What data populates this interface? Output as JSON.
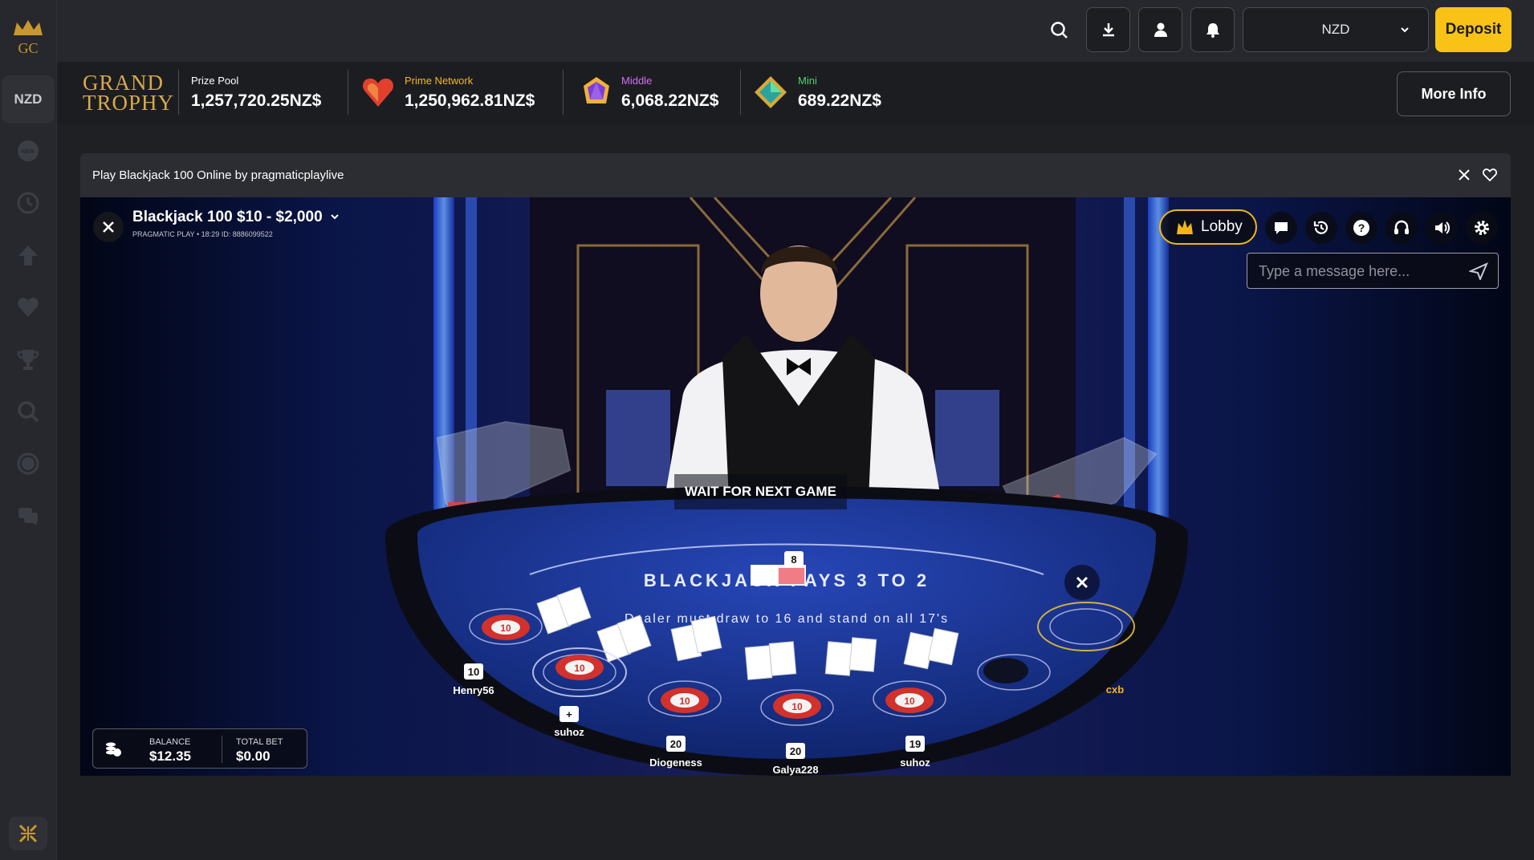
{
  "sidebar": {
    "logo_text": "GC",
    "currency": "NZD",
    "items": [
      {
        "icon": "new-icon"
      },
      {
        "icon": "recent-icon"
      },
      {
        "icon": "top-icon"
      },
      {
        "icon": "favorites-icon"
      },
      {
        "icon": "trophy-icon"
      },
      {
        "icon": "search-icon"
      },
      {
        "icon": "live-icon"
      },
      {
        "icon": "chat-icon"
      }
    ],
    "bottom_icon": "collapse-icon"
  },
  "topbar": {
    "currency_select": "NZD",
    "deposit_label": "Deposit"
  },
  "jackpot": {
    "logo_line1": "GRAND",
    "logo_line2": "TROPHY",
    "prize_pool_label": "Prize Pool",
    "prize_pool_value": "1,257,720.25NZ$",
    "prime_label": "Prime Network",
    "prime_value": "1,250,962.81NZ$",
    "middle_label": "Middle",
    "middle_value": "6,068.22NZ$",
    "mini_label": "Mini",
    "mini_value": "689.22NZ$",
    "more_info_label": "More Info",
    "colors": {
      "prime": "#f4b728",
      "middle": "#d56ef5",
      "mini": "#4fd27a"
    }
  },
  "game_panel": {
    "title": "Play Blackjack 100 Online by pragmaticplaylive",
    "game_title": "Blackjack 100 $10 - $2,000",
    "game_sub": "PRAGMATIC PLAY • 18:29  ID: 8886099522",
    "lobby_label": "Lobby",
    "chat_placeholder": "Type a message here...",
    "status": "WAIT FOR NEXT GAME",
    "table_text_1": "BLACKJACK PAYS 3 TO 2",
    "table_text_2": "Dealer must draw to 16 and stand on all 17's",
    "dealer_card_value": "8",
    "seats": [
      {
        "name": "Henry56",
        "score": "10"
      },
      {
        "name": "suhoz",
        "score": "+"
      },
      {
        "name": "Diogeness",
        "score": "20"
      },
      {
        "name": "Galya228",
        "score": "20"
      },
      {
        "name": "suhoz",
        "score": "19"
      },
      {
        "name": "cxb",
        "score": ""
      }
    ],
    "chip_value": "10",
    "balance_label": "BALANCE",
    "balance_value": "$12.35",
    "total_bet_label": "TOTAL BET",
    "total_bet_value": "$0.00"
  }
}
